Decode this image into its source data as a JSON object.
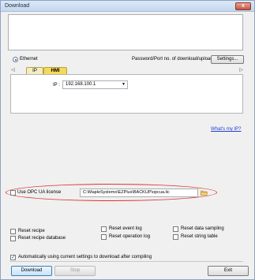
{
  "window": {
    "title": "Download",
    "close_glyph": "x"
  },
  "connection": {
    "ethernet_label": "Ethernet",
    "ethernet_selected": true,
    "password_port_label": "Password/Port no. of download/upload :",
    "settings_button": "Settings..."
  },
  "tabs": {
    "items": [
      {
        "label": "IP"
      },
      {
        "label": "HMI Name"
      }
    ],
    "selected": "HMI Name"
  },
  "ip_panel": {
    "label": "IP :",
    "value": "192.168.100.1"
  },
  "whats_my_ip": "What's my IP?",
  "opc": {
    "checkbox_label": "Use OPC UA license",
    "checked": false,
    "path": "C:\\MapleSystems\\EZPlus\\BACKUP\\opcua.lic",
    "browse_icon": "folder-open-icon"
  },
  "options": {
    "col1": [
      "Reset recipe",
      "Reset recipe database"
    ],
    "col2": [
      "Reset event log",
      "Reset operation log"
    ],
    "col3": [
      "Reset data sampling",
      "Reset string table"
    ],
    "auto_settings_label": "Automatically using current settings to download after compiling",
    "auto_settings_checked": true
  },
  "buttons": {
    "download": "Download",
    "stop": "Stop",
    "exit": "Exit"
  },
  "colors": {
    "highlight_ellipse": "#e03131",
    "link": "#1f3fd1",
    "active_tab": "#f5d95a"
  }
}
